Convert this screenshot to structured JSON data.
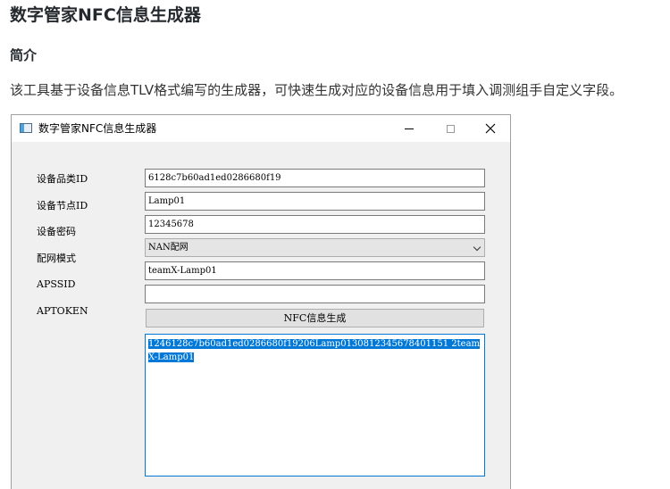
{
  "doc": {
    "title": "数字管家NFC信息生成器",
    "section_heading": "简介",
    "intro": "该工具基于设备信息TLV格式编写的生成器，可快速生成对应的设备信息用于填入调测组手自定义字段。"
  },
  "window": {
    "title": "数字管家NFC信息生成器",
    "buttons": {
      "minimize": "",
      "maximize": "",
      "close": "✕"
    }
  },
  "form": {
    "labels": {
      "product_id": "设备品类ID",
      "node_id": "设备节点ID",
      "password": "设备密码",
      "network_mode": "配网模式",
      "apssid": "APSSID",
      "aptoken": "APTOKEN"
    },
    "values": {
      "product_id": "6128c7b60ad1ed0286680f19",
      "node_id": "Lamp01",
      "password": "12345678",
      "network_mode": "NAN配网",
      "apssid": "teamX-Lamp01",
      "aptoken": ""
    },
    "generate_button": "NFC信息生成",
    "output": "1246128c7b60ad1ed0286680f19206Lamp0130812345678401151 2teamX-Lamp01"
  }
}
